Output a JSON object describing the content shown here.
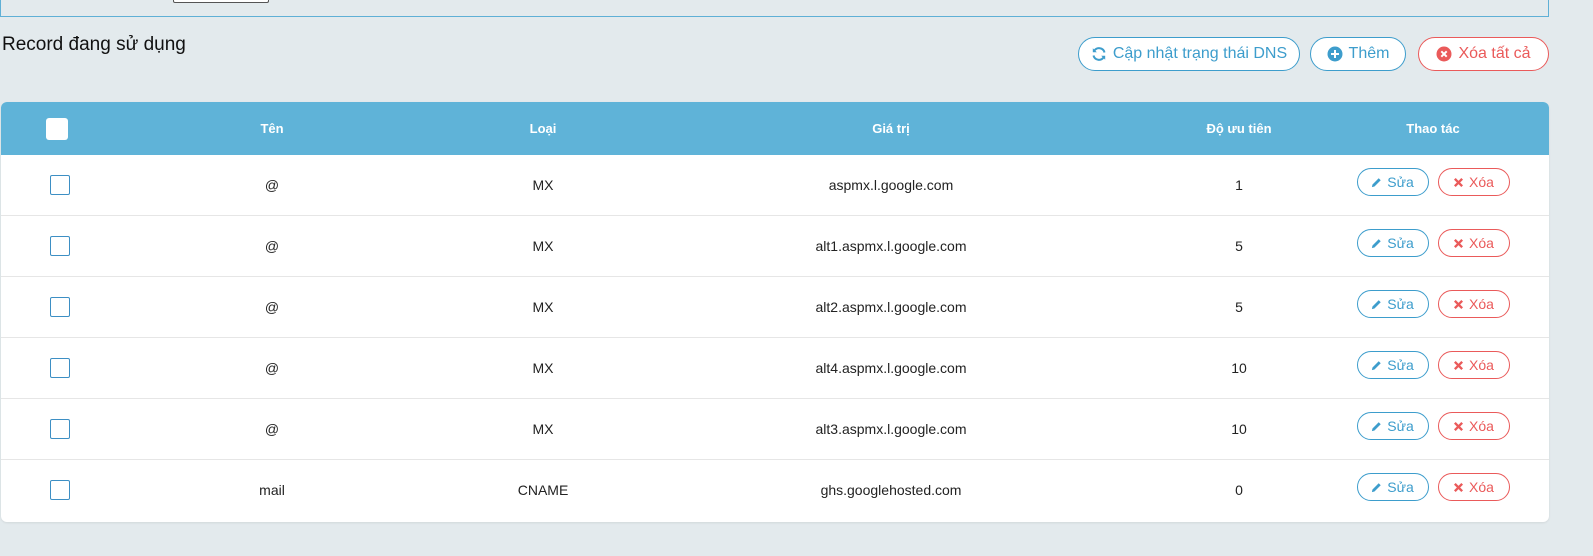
{
  "section": {
    "title": "Record đang sử dụng"
  },
  "toolbar": {
    "refresh_label": "Cập nhật trạng thái DNS",
    "add_label": "Thêm",
    "delete_all_label": "Xóa tất cả"
  },
  "table": {
    "headers": {
      "name": "Tên",
      "type": "Loại",
      "value": "Giá trị",
      "priority": "Độ ưu tiên",
      "actions": "Thao tác"
    },
    "edit_label": "Sửa",
    "delete_label": "Xóa",
    "rows": [
      {
        "name": "@",
        "type": "MX",
        "value": "aspmx.l.google.com",
        "priority": "1"
      },
      {
        "name": "@",
        "type": "MX",
        "value": "alt1.aspmx.l.google.com",
        "priority": "5"
      },
      {
        "name": "@",
        "type": "MX",
        "value": "alt2.aspmx.l.google.com",
        "priority": "5"
      },
      {
        "name": "@",
        "type": "MX",
        "value": "alt4.aspmx.l.google.com",
        "priority": "10"
      },
      {
        "name": "@",
        "type": "MX",
        "value": "alt3.aspmx.l.google.com",
        "priority": "10"
      },
      {
        "name": "mail",
        "type": "CNAME",
        "value": "ghs.googlehosted.com",
        "priority": "0"
      }
    ]
  },
  "icons": {
    "refresh": "refresh-icon",
    "add": "plus-circle-icon",
    "delete_all": "times-circle-icon",
    "edit": "pencil-icon",
    "delete": "times-icon"
  },
  "colors": {
    "accent": "#3d9dcc",
    "header_bg": "#5fb3d8",
    "danger": "#ea5a5a",
    "page_bg": "#e3eaed"
  }
}
